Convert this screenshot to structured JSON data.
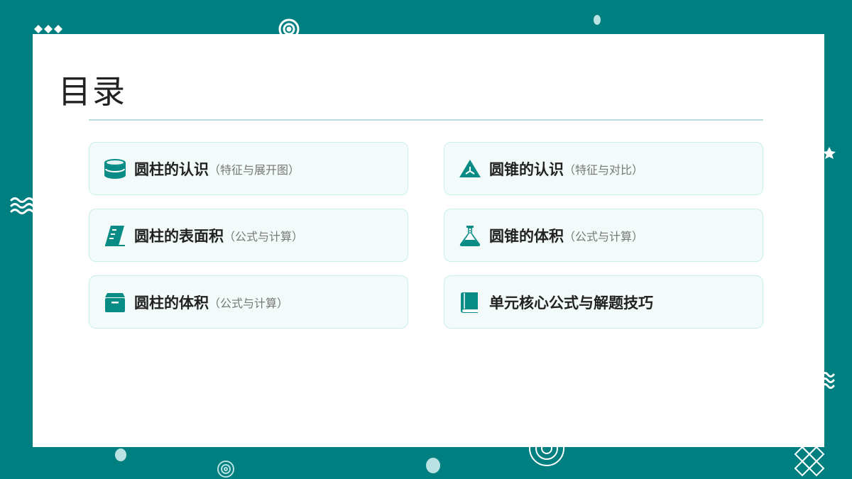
{
  "slide": {
    "title": "目录",
    "colors": {
      "background": "#007f80",
      "accent": "#0a8c86",
      "card": "#ffffff",
      "item_bg": "#f2fbfa",
      "item_border": "#c9efec"
    }
  },
  "items": [
    {
      "icon": "cylinder-icon",
      "label": "圆柱的认识",
      "sub": "（特征与展开图）"
    },
    {
      "icon": "cone-icon",
      "label": "圆锥的认识",
      "sub": "（特征与对比）"
    },
    {
      "icon": "ruler-icon",
      "label": "圆柱的表面积",
      "sub": "（公式与计算）"
    },
    {
      "icon": "flask-icon",
      "label": "圆锥的体积",
      "sub": "（公式与计算）"
    },
    {
      "icon": "box-icon",
      "label": "圆柱的体积",
      "sub": "（公式与计算）"
    },
    {
      "icon": "book-icon",
      "label": "单元核心公式与解题技巧",
      "sub": ""
    }
  ]
}
